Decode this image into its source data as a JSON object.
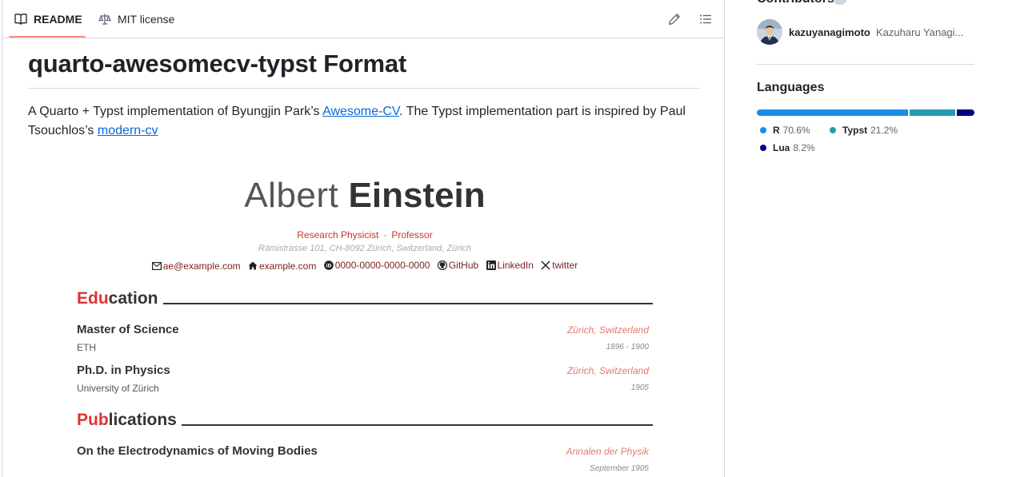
{
  "tabs": {
    "readme_label": "README",
    "license_label": "MIT license"
  },
  "readme": {
    "title": "quarto-awesomecv-typst Format",
    "desc_part1": "A Quarto + Typst implementation of Byungjin Park’s ",
    "desc_link1": "Awesome-CV",
    "desc_part2": ". The Typst implementation part is inspired by Paul Tsouchlos’s ",
    "desc_link2": "modern-cv"
  },
  "cv": {
    "first_name": "Albert",
    "last_name": "Einstein",
    "positions": [
      "Research Physicist",
      "Professor"
    ],
    "position_sep": "·",
    "address": "Rämistrasse 101, CH-8092 Zürich, Switzerland, Zürich",
    "contacts": {
      "email": "ae@example.com",
      "homepage": "example.com",
      "orcid": "0000-0000-0000-0000",
      "github": "GitHub",
      "linkedin": "LinkedIn",
      "twitter": "twitter"
    },
    "sections": {
      "education": {
        "accent": "Edu",
        "rest": "cation"
      },
      "publications": {
        "accent": "Pub",
        "rest": "lications"
      }
    },
    "education": [
      {
        "title": "Master of Science",
        "institution": "ETH",
        "location": "Zürich, Switzerland",
        "date": "1896 - 1900"
      },
      {
        "title": "Ph.D. in Physics",
        "institution": "University of Zürich",
        "location": "Zürich, Switzerland",
        "date": "1905"
      }
    ],
    "publications": [
      {
        "title": "On the Electrodynamics of Moving Bodies",
        "venue": "Annalen der Physik",
        "date": "September 1905"
      }
    ]
  },
  "sidebar": {
    "contributors_title": "Contributors",
    "contributor": {
      "login": "kazuyanagimoto",
      "name": "Kazuharu Yanagi..."
    },
    "languages_title": "Languages",
    "languages": [
      {
        "name": "R",
        "percent": "70.6%",
        "share": 70.6,
        "color": "#198ce7"
      },
      {
        "name": "Typst",
        "percent": "21.2%",
        "share": 21.2,
        "color": "#239dad"
      },
      {
        "name": "Lua",
        "percent": "8.2%",
        "share": 8.2,
        "color": "#000080"
      }
    ]
  }
}
